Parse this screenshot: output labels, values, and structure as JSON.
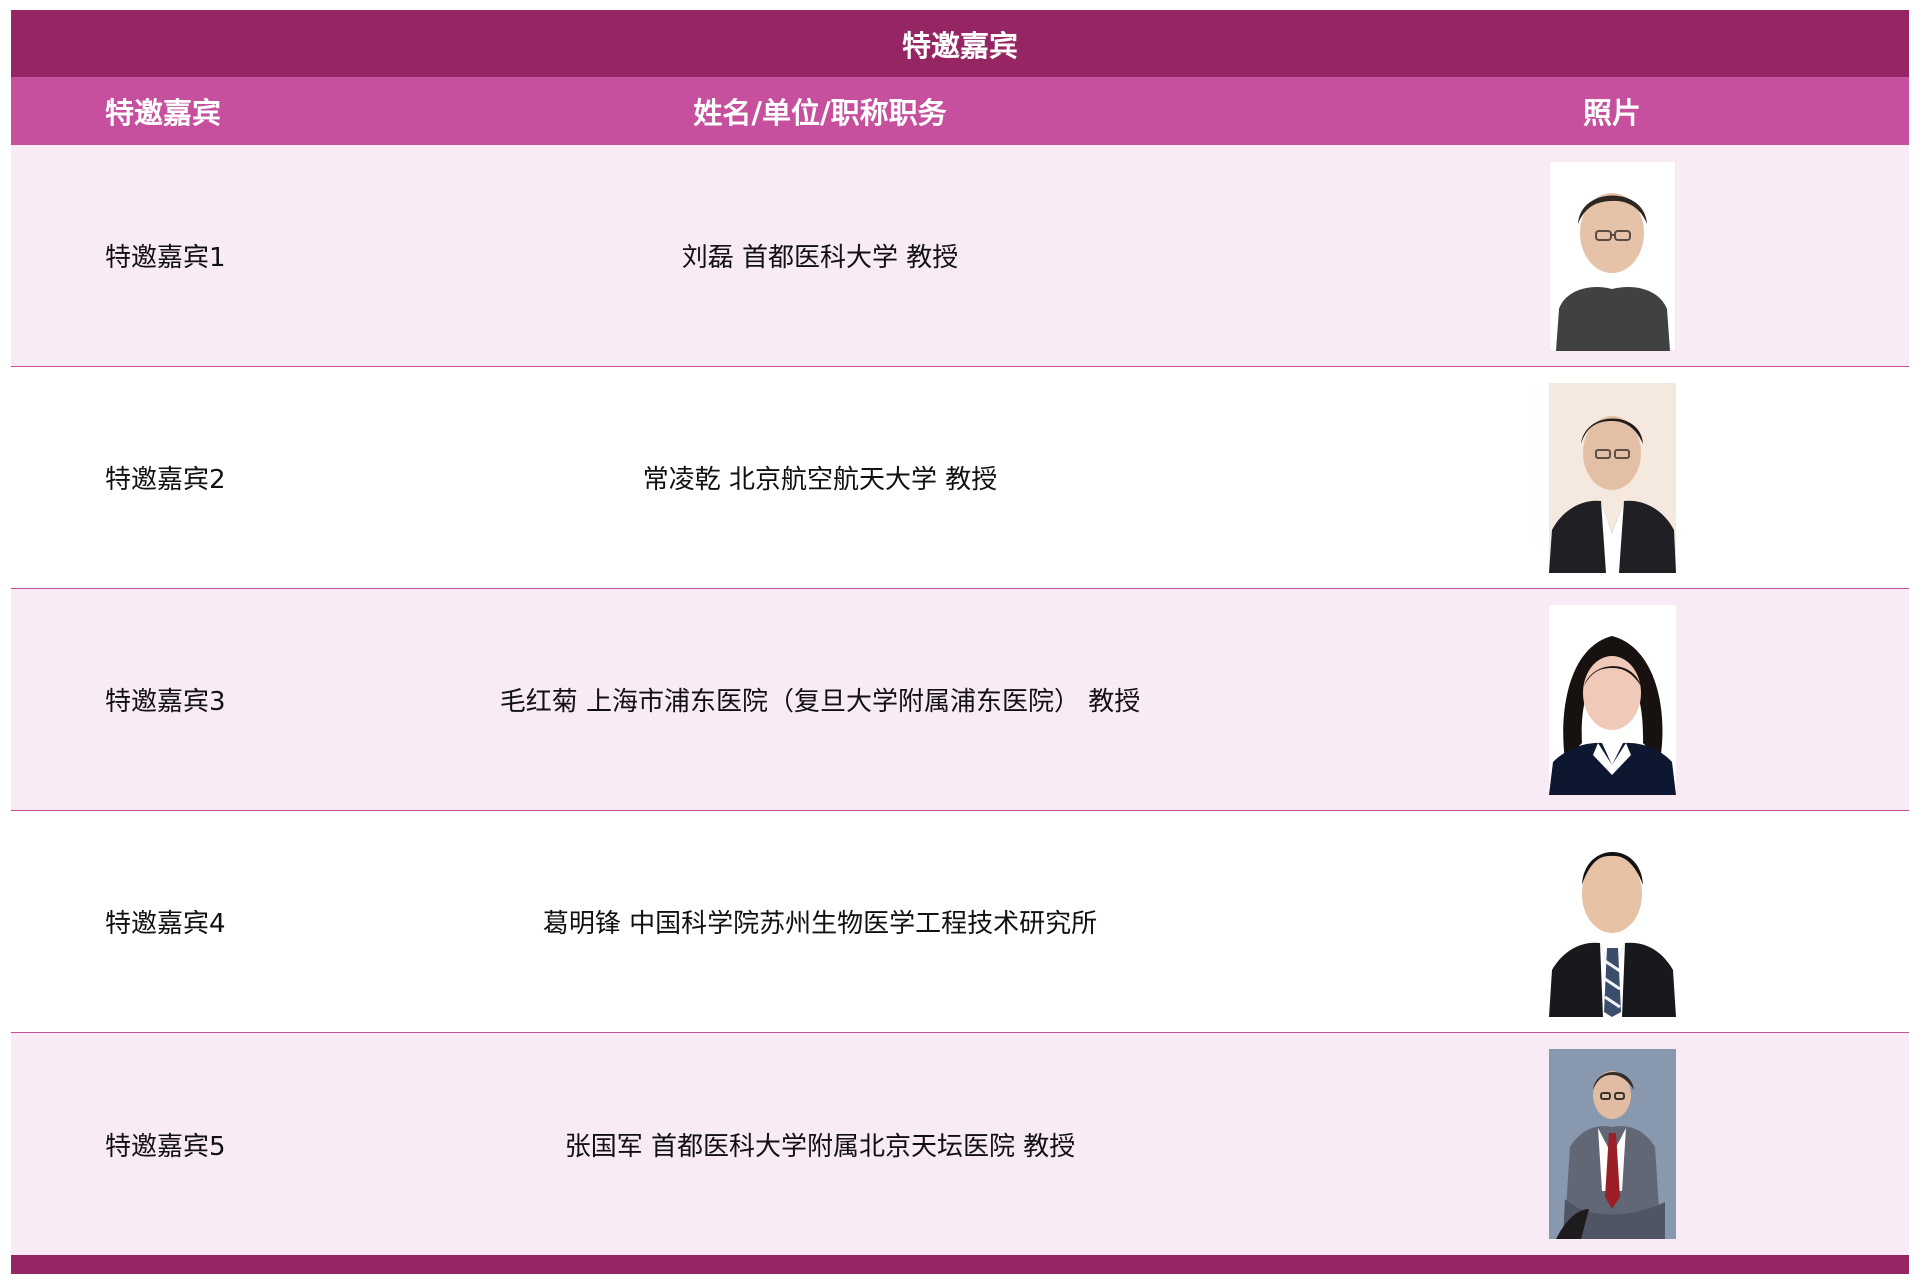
{
  "table": {
    "title": "特邀嘉宾",
    "headers": {
      "role": "特邀嘉宾",
      "name_unit_title": "姓名/单位/职称职务",
      "photo": "照片"
    },
    "rows": [
      {
        "role": "特邀嘉宾1",
        "info": "刘磊 首都医科大学 教授",
        "photo_icon": "person-photo-icon",
        "photo_bg": "#ffffff",
        "photo_shirt": "#414141",
        "photo_hair": "#2f2622"
      },
      {
        "role": "特邀嘉宾2",
        "info": "常凌乾 北京航空航天大学 教授",
        "photo_icon": "person-photo-icon",
        "photo_bg": "#f4e8df",
        "photo_shirt": "#1f1f24",
        "photo_hair": "#211a17"
      },
      {
        "role": "特邀嘉宾3",
        "info": "毛红菊 上海市浦东医院（复旦大学附属浦东医院） 教授",
        "photo_icon": "person-photo-icon",
        "photo_bg": "#ffffff",
        "photo_shirt": "#0e1730",
        "photo_hair": "#17110f"
      },
      {
        "role": "特邀嘉宾4",
        "info": "葛明锋 中国科学院苏州生物医学工程技术研究所",
        "photo_icon": "person-photo-icon",
        "photo_bg": "#ffffff",
        "photo_shirt": "#18191d",
        "photo_hair": "#111111"
      },
      {
        "role": "特邀嘉宾5",
        "info": "张国军 首都医科大学附属北京天坛医院 教授",
        "photo_icon": "person-photo-icon",
        "photo_bg": "#7d8ea8",
        "photo_shirt": "#626776",
        "photo_hair": "#332c2a"
      }
    ]
  },
  "colors": {
    "title_bar": "#962563",
    "header_row": "#c64f9e",
    "row_pink": "#f9ebf5",
    "row_white": "#ffffff",
    "divider": "#c64f9e",
    "text": "#111111",
    "header_text": "#ffffff"
  }
}
